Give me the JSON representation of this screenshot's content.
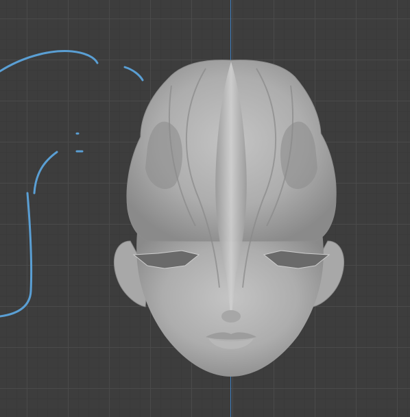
{
  "viewport": {
    "mode": "3d-viewport",
    "background_color": "#3d3d3d",
    "grid_color": "#4b4b4b",
    "axis_color": "#3f7fbf",
    "stroke_color": "#5a9fd4",
    "mesh_color": "#b5b5b5"
  }
}
